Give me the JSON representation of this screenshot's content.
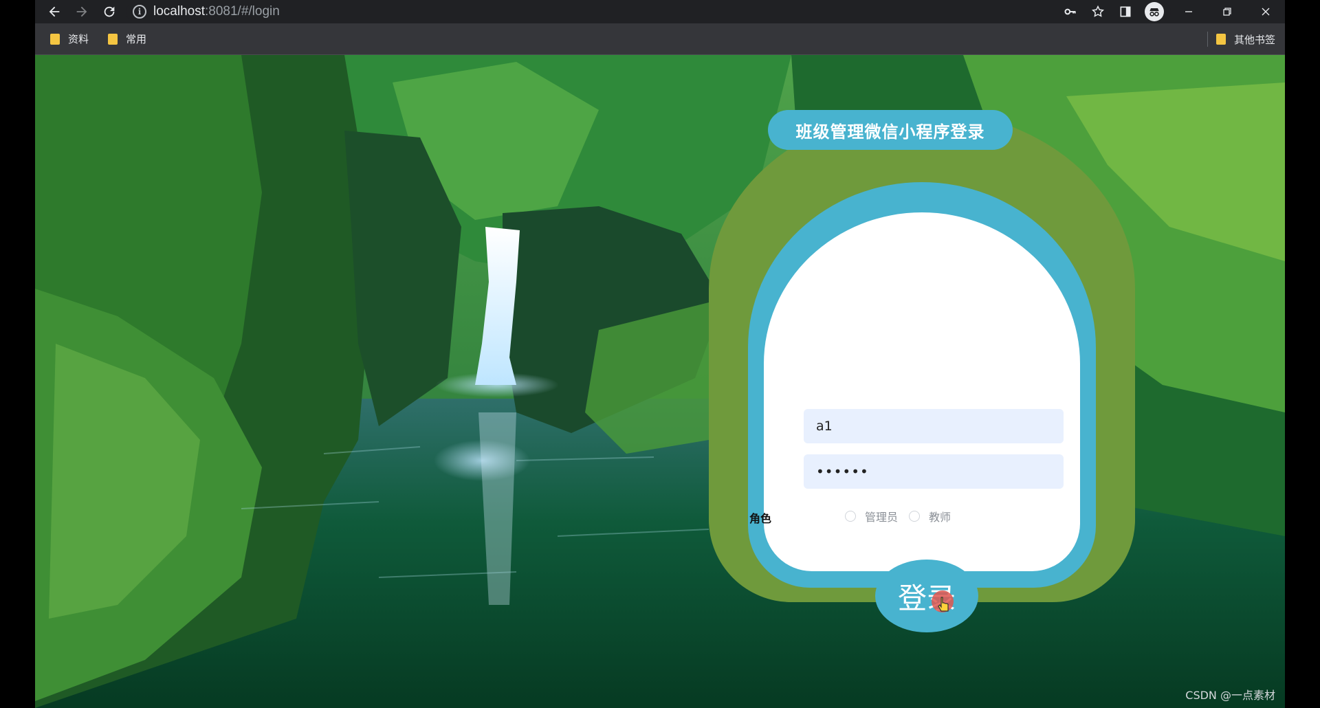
{
  "browser": {
    "url_host": "localhost",
    "url_path": ":8081/#/login",
    "bookmarks": [
      "资料",
      "常用"
    ],
    "other_bookmarks": "其他书签"
  },
  "login": {
    "title": "班级管理微信小程序登录",
    "username_value": "a1",
    "password_mask": "••••••",
    "role_label": "角色",
    "roles": [
      "管理员",
      "教师"
    ],
    "submit_label": "登录"
  },
  "colors": {
    "card_outer": "#6f9a3c",
    "card_accent": "#48b3cf",
    "input_bg": "#e8f0fe"
  },
  "watermark": "CSDN @一点素材"
}
